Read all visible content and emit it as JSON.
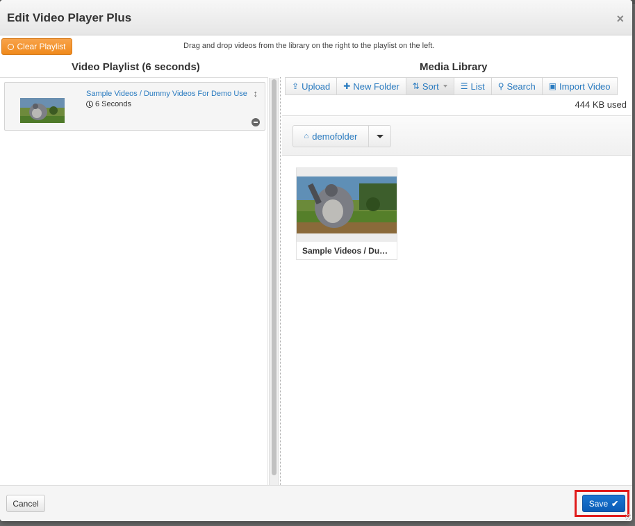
{
  "modal": {
    "title": "Edit Video Player Plus",
    "close_label": "×"
  },
  "toolbar": {
    "clear_label": "Clear Playlist",
    "hint": "Drag and drop videos from the library on the right to the playlist on the left."
  },
  "playlist": {
    "title": "Video Playlist (6 seconds)",
    "items": [
      {
        "title": "Sample Videos / Dummy Videos For Demo Use",
        "duration": "6 Seconds",
        "thumbnail_icon": "video-thumbnail"
      }
    ]
  },
  "library": {
    "title": "Media Library",
    "buttons": {
      "upload": "Upload",
      "new_folder": "New Folder",
      "sort": "Sort",
      "list": "List",
      "search": "Search",
      "import": "Import Video"
    },
    "usage": "444 KB used",
    "folder": "demofolder",
    "items": [
      {
        "caption": "Sample Videos / Dummy Videos For Demo Use"
      }
    ]
  },
  "footer": {
    "cancel_label": "Cancel",
    "save_label": "Save"
  },
  "colors": {
    "accent": "#2a7bc0",
    "orange": "#f08a1c",
    "save": "#0a5bb5",
    "highlight": "#e01b1b"
  }
}
